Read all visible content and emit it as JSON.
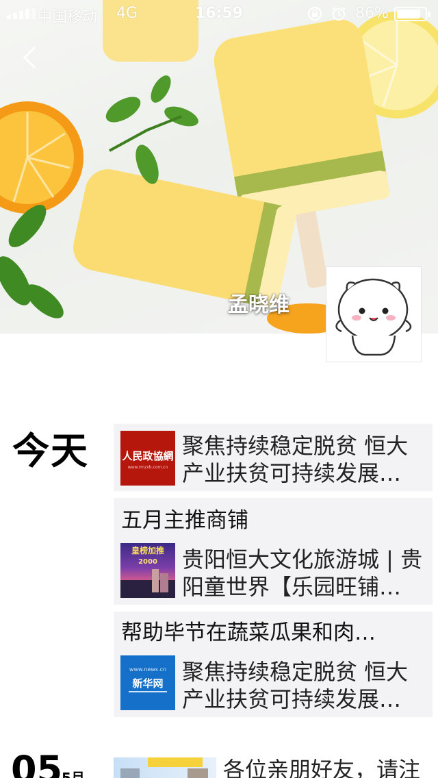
{
  "status_bar": {
    "carrier": "中国移动",
    "network": "4G",
    "time": "16:59",
    "battery_percent": "86%",
    "battery_level": 0.86
  },
  "profile": {
    "name": "孟晓维",
    "cover_description_icon": "popsicle-cover-image",
    "avatar_icon": "white-cat-avatar"
  },
  "timeline": {
    "today_label": "今天",
    "posts": [
      {
        "title": "",
        "text": "聚焦持续稳定脱贫 恒大产业扶贫可持续发展…",
        "thumb_caption": "人民政協網",
        "thumb_sub": "www.rmzxb.com.cn"
      },
      {
        "title": "五月主推商铺",
        "text": "贵阳恒大文化旅游城 | 贵阳童世界【乐园旺铺…",
        "thumb_caption": "皇榜加推",
        "thumb_sub": "2000"
      },
      {
        "title": "帮助毕节在蔬菜瓜果和肉…",
        "text": "聚焦持续稳定脱贫 恒大产业扶贫可持续发展…",
        "thumb_caption": "新华网",
        "thumb_sub": "www.news.cn"
      }
    ],
    "next_day": {
      "day": "05",
      "month": "5月",
      "text": "各位亲朋好友，请注"
    }
  },
  "colors": {
    "card_bg": "#f3f3f5",
    "rmzx_red": "#b5170c",
    "xinhua_blue": "#1570c9"
  }
}
